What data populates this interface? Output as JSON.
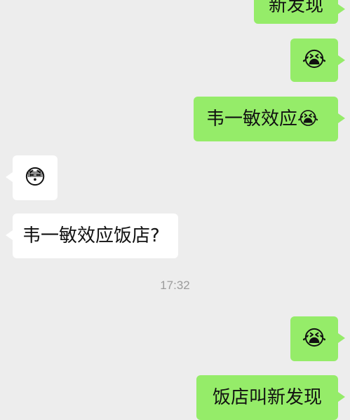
{
  "messages": [
    {
      "side": "outgoing",
      "text": "新发现",
      "emoji": ""
    },
    {
      "side": "outgoing",
      "text": "",
      "emoji": "😭"
    },
    {
      "side": "outgoing",
      "text": "韦一敏效应",
      "emoji": "😭"
    },
    {
      "side": "incoming",
      "text": "",
      "emoji": "😳"
    },
    {
      "side": "incoming",
      "text": "韦一敏效应饭店?",
      "emoji": ""
    },
    {
      "side": "outgoing",
      "text": "",
      "emoji": "😭"
    },
    {
      "side": "outgoing",
      "text": "饭店叫新发现",
      "emoji": ""
    }
  ],
  "timestamp": "17:32",
  "colors": {
    "outgoing_bubble": "#95ec69",
    "incoming_bubble": "#ffffff",
    "background": "#ededed"
  },
  "icons": {
    "crying_face": "loudly-crying-face-emoji",
    "flushed_face": "flushed-face-emoji"
  }
}
